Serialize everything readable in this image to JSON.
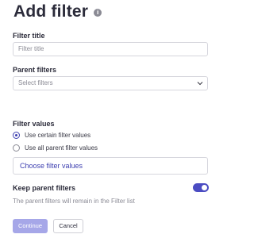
{
  "header": {
    "title": "Add filter",
    "info_icon": "info-icon"
  },
  "filter_title": {
    "label": "Filter title",
    "placeholder": "Filter title",
    "value": ""
  },
  "parent_filters": {
    "label": "Parent filters",
    "selected": "Select filters",
    "icon": "chevron-down-icon"
  },
  "filter_values": {
    "label": "Filter values",
    "options": [
      {
        "label": "Use certain filter values",
        "checked": true
      },
      {
        "label": "Use all parent filter values",
        "checked": false
      }
    ],
    "choose_label": "Choose filter values"
  },
  "keep_parent": {
    "label": "Keep parent filters",
    "enabled": true,
    "hint": "The parent filters will remain in the Filter list"
  },
  "actions": {
    "continue_label": "Continue",
    "cancel_label": "Cancel"
  },
  "colors": {
    "accent": "#4b4cc2",
    "continue_disabled": "#a6a7e8",
    "text": "#2b2b3a",
    "muted": "#8c8c96"
  }
}
